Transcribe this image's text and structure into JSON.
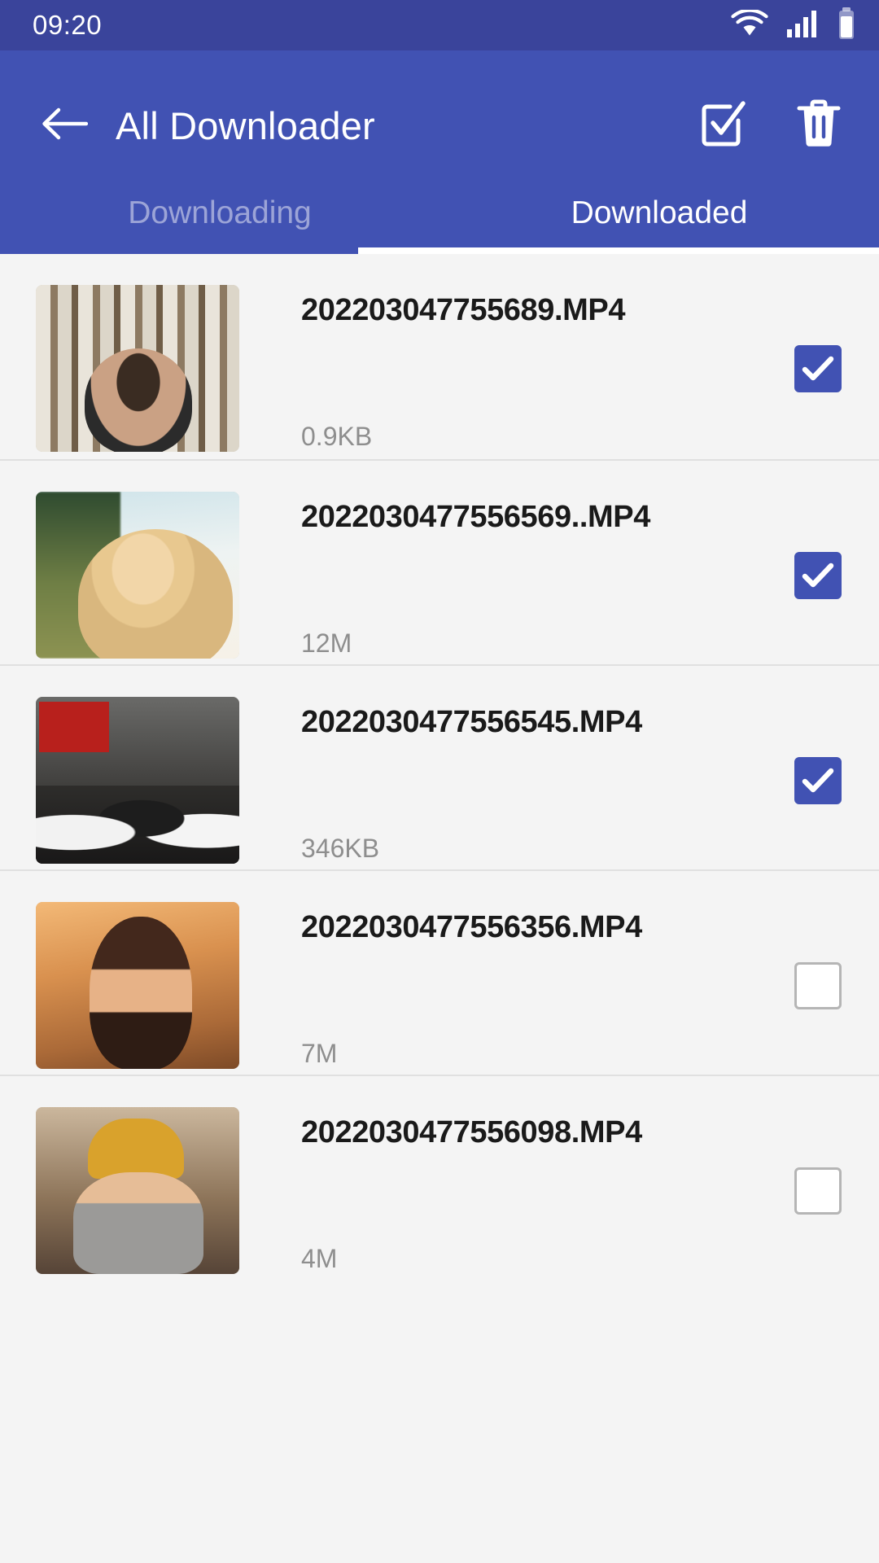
{
  "statusbar": {
    "time": "09:20",
    "icons": [
      "wifi-icon",
      "signal-icon",
      "battery-icon"
    ]
  },
  "appbar": {
    "back_icon": "back-arrow-icon",
    "title": "All Downloader",
    "select_all_icon": "checkbox-checked-icon",
    "delete_icon": "trash-icon"
  },
  "tabs": {
    "items": [
      {
        "label": "Downloading",
        "active": false
      },
      {
        "label": "Downloaded",
        "active": true
      }
    ]
  },
  "colors": {
    "statusbar_bg": "#3a449b",
    "appbar_bg": "#4152b3",
    "accent": "#4152b3",
    "list_bg": "#f4f4f4",
    "title_text": "#1a1a1a",
    "size_text": "#8e8e8e",
    "divider": "#e0e0e0",
    "tab_inactive": "rgba(255,255,255,0.48)",
    "tab_active": "#ffffff"
  },
  "list": {
    "items": [
      {
        "name": "202203047755689.MP4",
        "size": "0.9KB",
        "checked": true,
        "thumb": "art-stripes"
      },
      {
        "name": "2022030477556569..MP4",
        "size": "12M",
        "checked": true,
        "thumb": "art-sky"
      },
      {
        "name": "2022030477556545.MP4",
        "size": "346KB",
        "checked": true,
        "thumb": "art-wall"
      },
      {
        "name": "2022030477556356.MP4",
        "size": "7M",
        "checked": false,
        "thumb": "art-field"
      },
      {
        "name": "2022030477556098.MP4",
        "size": "4M",
        "checked": false,
        "thumb": "art-cafe"
      }
    ]
  }
}
